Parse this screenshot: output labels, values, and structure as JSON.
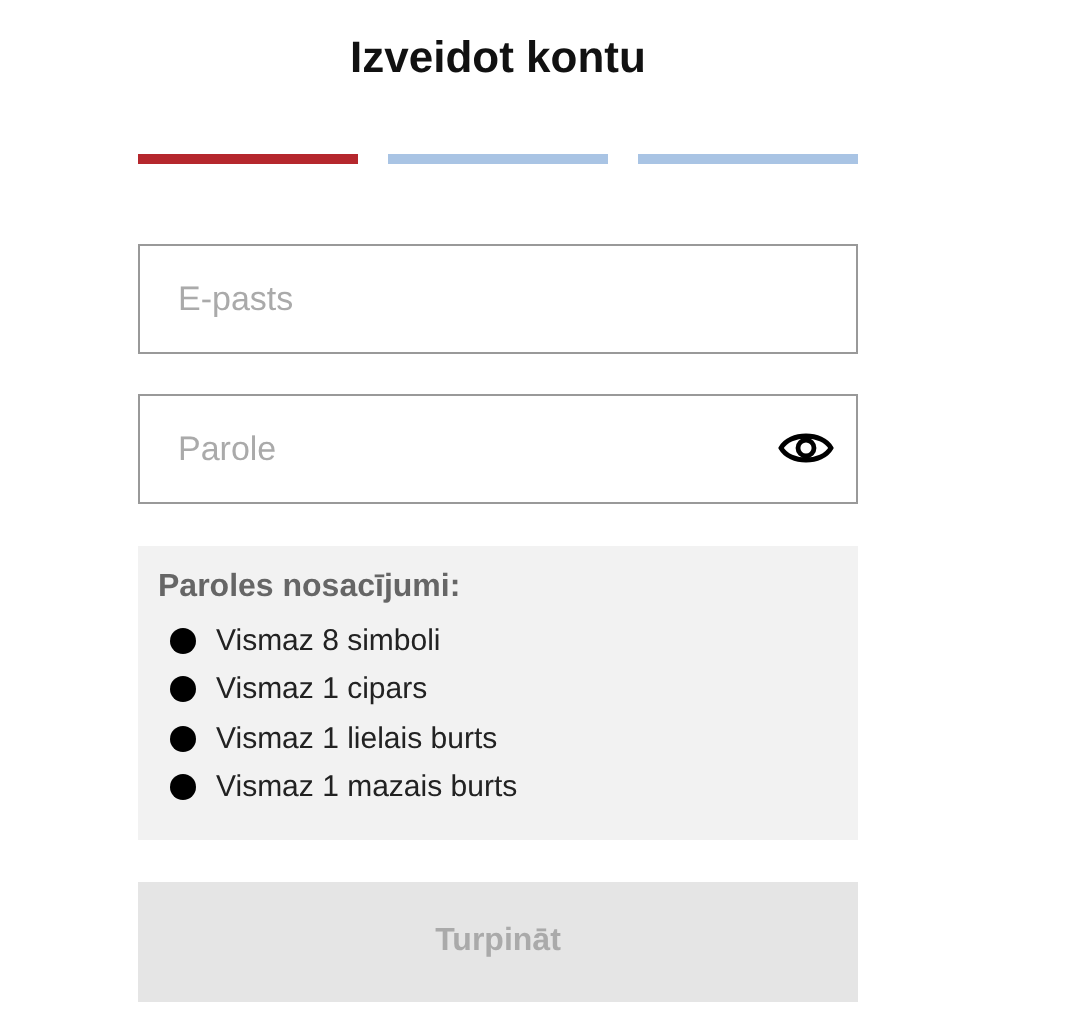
{
  "title": "Izveidot kontu",
  "steps": [
    {
      "active": true
    },
    {
      "active": false
    },
    {
      "active": false
    }
  ],
  "email_field": {
    "placeholder": "E-pasts"
  },
  "password_field": {
    "placeholder": "Parole"
  },
  "requirements": {
    "heading": "Paroles nosacījumi:",
    "items": [
      "Vismaz 8 simboli",
      "Vismaz 1 cipars",
      "Vismaz 1 lielais burts",
      "Vismaz 1 mazais burts"
    ]
  },
  "continue_button": {
    "label": "Turpināt",
    "disabled": true
  }
}
